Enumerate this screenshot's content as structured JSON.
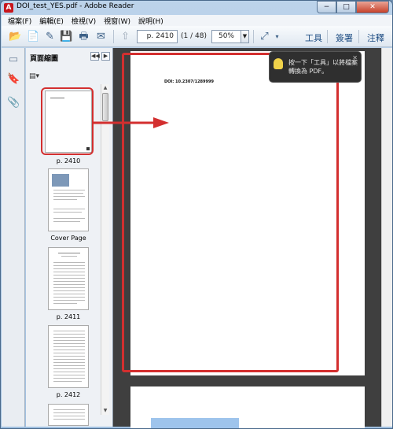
{
  "window": {
    "title": "DOI_test_YES.pdf - Adobe Reader",
    "app_icon": "adobe-reader-icon",
    "minimize": "−",
    "maximize": "□",
    "close": "✕"
  },
  "menu": [
    "檔案(F)",
    "編輯(E)",
    "檢視(V)",
    "視窗(W)",
    "說明(H)"
  ],
  "toolbar": {
    "page_value": "p. 2410",
    "page_count": "(1 / 48)",
    "zoom_value": "50%",
    "tools_label": "工具",
    "sign_label": "簽署",
    "comment_label": "注釋"
  },
  "thumbnails_panel": {
    "title": "頁面縮圖",
    "items": [
      {
        "label": "p. 2410"
      },
      {
        "label": "Cover Page"
      },
      {
        "label": "p. 2411"
      },
      {
        "label": "p. 2412"
      }
    ]
  },
  "document": {
    "doi_text": "DOI: 10.2307/1289999"
  },
  "tooltip": {
    "text": "按一下「工具」以將檔案轉換為 PDF。"
  },
  "colors": {
    "annotation_red": "#d32f2f",
    "document_background": "#3f3f3f"
  }
}
